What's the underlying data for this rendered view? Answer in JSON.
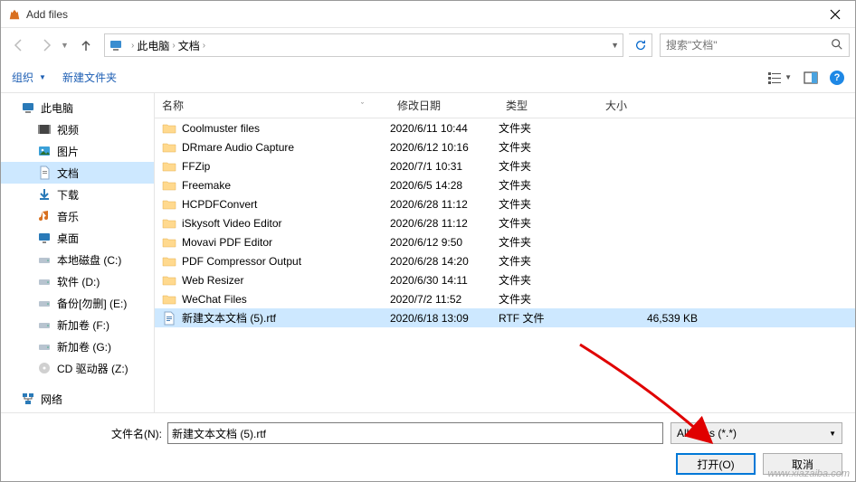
{
  "window": {
    "title": "Add files"
  },
  "nav": {
    "breadcrumb": {
      "root": "此电脑",
      "folder": "文档"
    },
    "search_placeholder": "搜索\"文档\""
  },
  "toolbar": {
    "organize": "组织",
    "new_folder": "新建文件夹"
  },
  "sidebar": {
    "items": [
      {
        "label": "此电脑",
        "type": "pc",
        "level": 1
      },
      {
        "label": "视频",
        "type": "video",
        "level": 2
      },
      {
        "label": "图片",
        "type": "pictures",
        "level": 2
      },
      {
        "label": "文档",
        "type": "documents",
        "level": 2,
        "selected": true
      },
      {
        "label": "下载",
        "type": "downloads",
        "level": 2
      },
      {
        "label": "音乐",
        "type": "music",
        "level": 2
      },
      {
        "label": "桌面",
        "type": "desktop",
        "level": 2
      },
      {
        "label": "本地磁盘 (C:)",
        "type": "drive",
        "level": 2
      },
      {
        "label": "软件 (D:)",
        "type": "drive",
        "level": 2
      },
      {
        "label": "备份[勿删] (E:)",
        "type": "drive",
        "level": 2
      },
      {
        "label": "新加卷 (F:)",
        "type": "drive",
        "level": 2
      },
      {
        "label": "新加卷 (G:)",
        "type": "drive",
        "level": 2
      },
      {
        "label": "CD 驱动器 (Z:)",
        "type": "cd",
        "level": 2
      }
    ],
    "network": "网络"
  },
  "columns": {
    "name": "名称",
    "date": "修改日期",
    "type": "类型",
    "size": "大小"
  },
  "files": [
    {
      "name": "Coolmuster files",
      "date": "2020/6/11 10:44",
      "type": "文件夹",
      "size": "",
      "icon": "folder"
    },
    {
      "name": "DRmare Audio Capture",
      "date": "2020/6/12 10:16",
      "type": "文件夹",
      "size": "",
      "icon": "folder"
    },
    {
      "name": "FFZip",
      "date": "2020/7/1 10:31",
      "type": "文件夹",
      "size": "",
      "icon": "folder"
    },
    {
      "name": "Freemake",
      "date": "2020/6/5 14:28",
      "type": "文件夹",
      "size": "",
      "icon": "folder"
    },
    {
      "name": "HCPDFConvert",
      "date": "2020/6/28 11:12",
      "type": "文件夹",
      "size": "",
      "icon": "folder"
    },
    {
      "name": "iSkysoft Video Editor",
      "date": "2020/6/28 11:12",
      "type": "文件夹",
      "size": "",
      "icon": "folder"
    },
    {
      "name": "Movavi PDF Editor",
      "date": "2020/6/12 9:50",
      "type": "文件夹",
      "size": "",
      "icon": "folder"
    },
    {
      "name": "PDF Compressor Output",
      "date": "2020/6/28 14:20",
      "type": "文件夹",
      "size": "",
      "icon": "folder"
    },
    {
      "name": "Web Resizer",
      "date": "2020/6/30 14:11",
      "type": "文件夹",
      "size": "",
      "icon": "folder"
    },
    {
      "name": "WeChat Files",
      "date": "2020/7/2 11:52",
      "type": "文件夹",
      "size": "",
      "icon": "folder"
    },
    {
      "name": "新建文本文档 (5).rtf",
      "date": "2020/6/18 13:09",
      "type": "RTF 文件",
      "size": "46,539 KB",
      "icon": "rtf",
      "selected": true
    }
  ],
  "footer": {
    "filename_label": "文件名(N):",
    "filename_value": "新建文本文档 (5).rtf",
    "filter": "All Files (*.*)",
    "open": "打开(O)",
    "cancel": "取消"
  },
  "watermark": "www.xiazaiba.com"
}
